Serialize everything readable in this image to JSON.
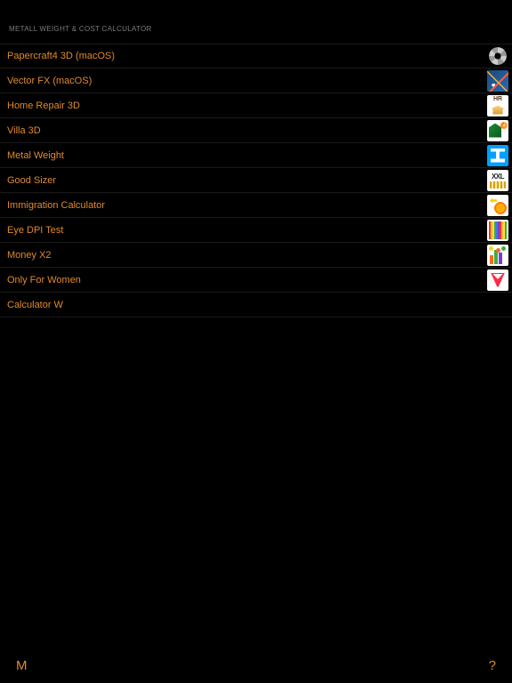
{
  "header": {
    "title": "METALL WEIGHT & COST CALCULATOR"
  },
  "list": {
    "items": [
      {
        "label": "Papercraft4 3D (macOS)",
        "icon": "papercraft-icon"
      },
      {
        "label": "Vector FX (macOS)",
        "icon": "vectorfx-icon"
      },
      {
        "label": "Home Repair 3D",
        "icon": "homerepair-icon"
      },
      {
        "label": "Villa 3D",
        "icon": "villa-icon"
      },
      {
        "label": "Metal Weight",
        "icon": "metalweight-icon"
      },
      {
        "label": "Good Sizer",
        "icon": "goodsizer-icon"
      },
      {
        "label": "Immigration Calculator",
        "icon": "immigration-icon"
      },
      {
        "label": "Eye DPI Test",
        "icon": "eyedpi-icon"
      },
      {
        "label": "Money X2",
        "icon": "moneyx2-icon"
      },
      {
        "label": "Only For Women",
        "icon": "onlyforwomen-icon"
      },
      {
        "label": "Calculator W",
        "icon": "calculatorw-icon"
      }
    ]
  },
  "footer": {
    "left": "M",
    "right": "?"
  },
  "colors": {
    "accent": "#e08a2c",
    "background": "#000000",
    "divider": "#1a1a1a",
    "header_text": "#7a7a7a"
  }
}
